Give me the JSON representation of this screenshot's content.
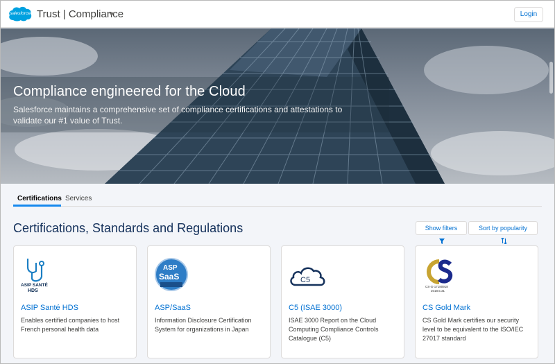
{
  "header": {
    "title": "Trust | Compliance",
    "logo_text": "salesforce",
    "login_label": "Login"
  },
  "hero": {
    "title": "Compliance engineered for the Cloud",
    "subtitle": "Salesforce maintains a comprehensive set of compliance certifications and attestations to validate our #1 value of Trust."
  },
  "tabs": [
    {
      "label": "Certifications",
      "active": true
    },
    {
      "label": "Services",
      "active": false
    }
  ],
  "section": {
    "title": "Certifications, Standards and Regulations",
    "filter_label": "Show filters",
    "sort_label": "Sort by popularity"
  },
  "cards": [
    {
      "title": "ASIP Santé HDS",
      "description": "Enables certified companies to host French personal health data",
      "logo_text_1": "ASIP SANTÉ",
      "logo_text_2": "HDS",
      "icon": "stethoscope-icon"
    },
    {
      "title": "ASP/SaaS",
      "description": "Information Disclosure Certification System for organizations in Japan",
      "logo_text_1": "ASP",
      "logo_text_2": "SaaS",
      "icon": "asp-saas-badge-icon"
    },
    {
      "title": "C5 (ISAE 3000)",
      "description": "ISAE 3000 Report on the Cloud Computing Compliance Controls Catalogue (C5)",
      "logo_text_1": "C5",
      "icon": "cloud-icon"
    },
    {
      "title": "CS Gold Mark",
      "description": "CS Gold Mark certifies our security level to be equivalent to the ISO/IEC 27017 standard",
      "logo_text_1": "CS-G-17180918",
      "logo_text_2": "2018.5.31",
      "icon": "cs-gold-mark-icon"
    }
  ],
  "colors": {
    "brand": "#00a1e0",
    "link": "#0070d2",
    "heading": "#16325c",
    "tab_accent": "#1589ee"
  }
}
